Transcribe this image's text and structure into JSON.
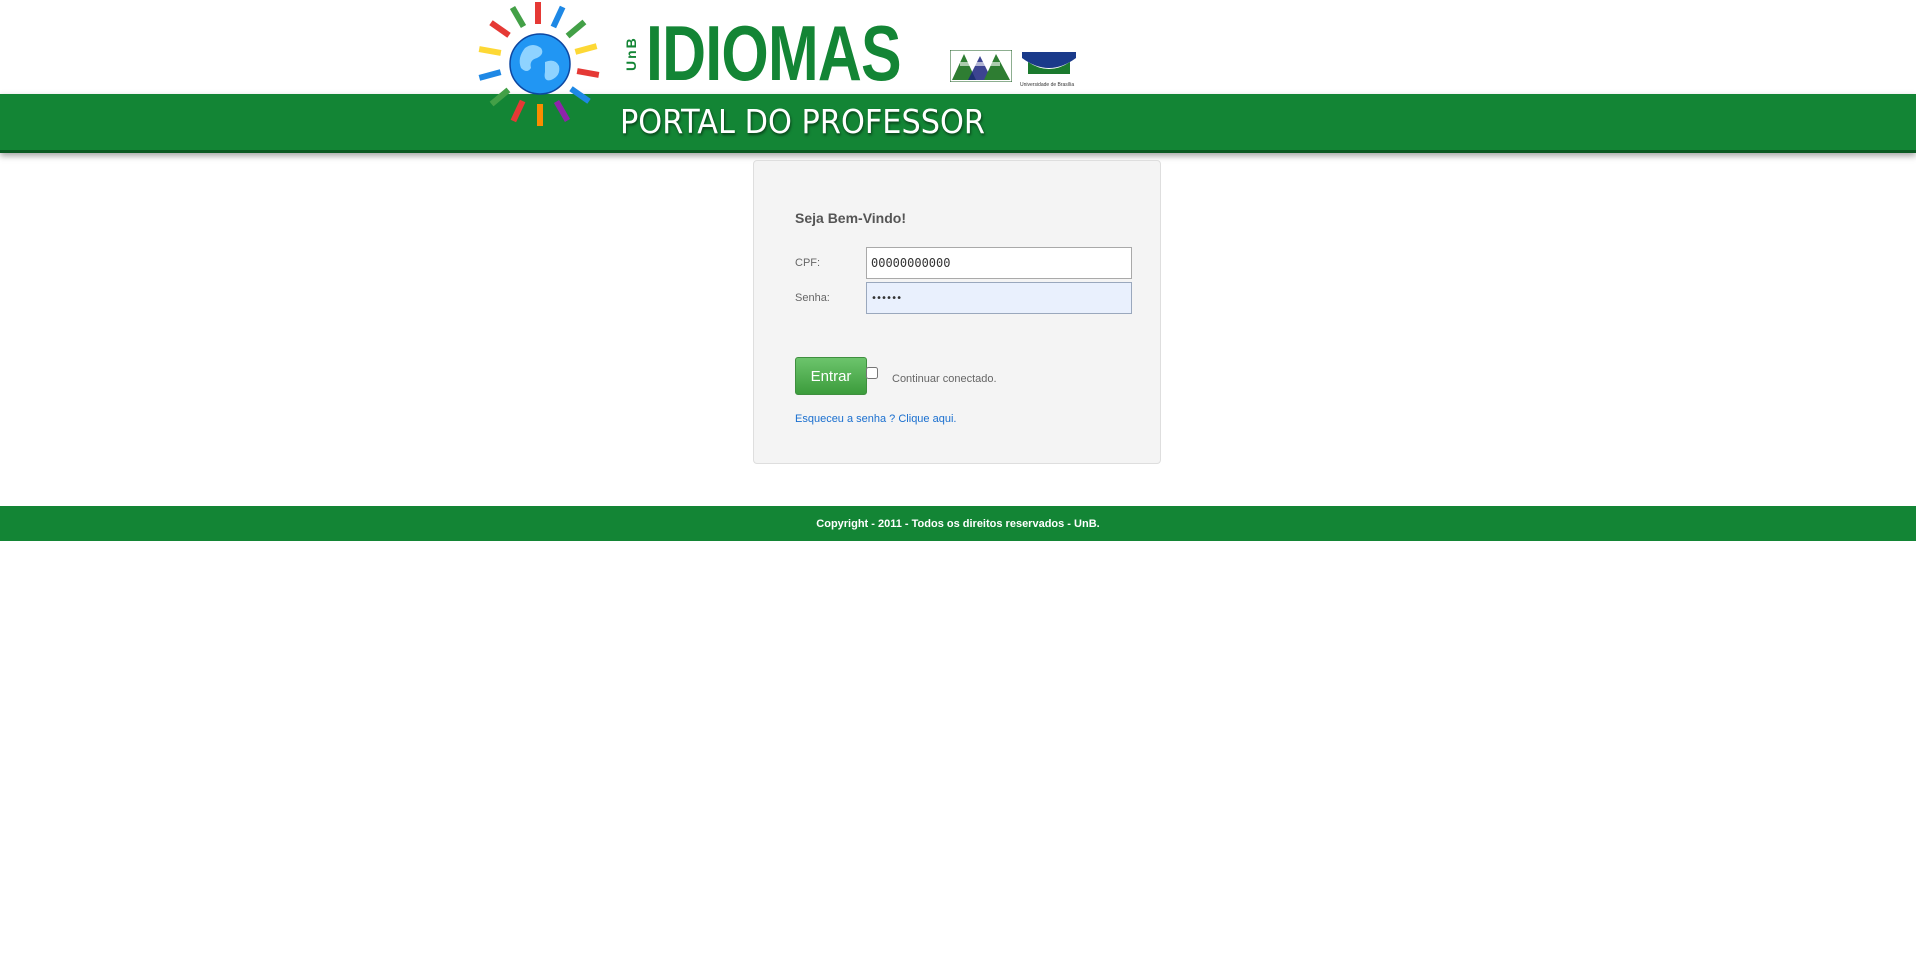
{
  "header": {
    "brand_prefix": "UnB",
    "brand_title": "IDIOMAS",
    "subtitle": "PORTAL DO PROFESSOR",
    "logo_b_caption": "Universidade de Brasília"
  },
  "login": {
    "welcome": "Seja Bem-Vindo!",
    "cpf_label": "CPF:",
    "cpf_value": "00000000000",
    "senha_label": "Senha:",
    "senha_value": "••••••",
    "submit_label": "Entrar",
    "remember_label": "Continuar conectado.",
    "remember_checked": false,
    "forgot_link": "Esqueceu a senha ? Clique aqui."
  },
  "footer": {
    "copyright": "Copyright - 2011 - Todos os direitos reservados - UnB."
  },
  "colors": {
    "brand_green": "#138535",
    "link_blue": "#1a6fcf",
    "button_green": "#4caf50"
  },
  "icons": [
    "globe-people-logo",
    "institute-logo",
    "unb-logo"
  ]
}
